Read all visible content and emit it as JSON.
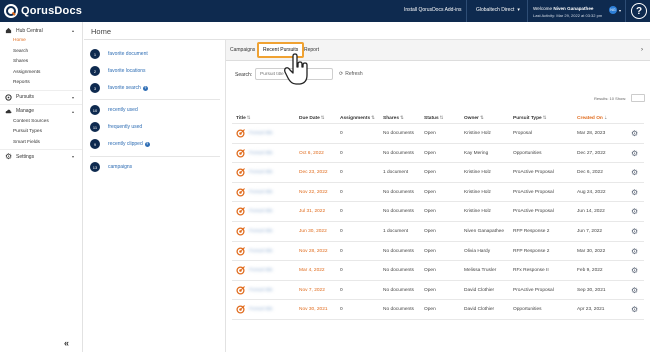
{
  "brand": {
    "name": "QorusDocs"
  },
  "topbar": {
    "addin_link": "Install QorusDocs Add-ins",
    "org": "Globaltech Direct",
    "welcome_prefix": "Welcome",
    "user_name": "Niven Ganapathee",
    "last_activity": "Last Activity: Mar 29, 2022 at 03:32 pm",
    "avatar_initials": "NG",
    "help": "?"
  },
  "sidebar": {
    "hub_central": "Hub Central",
    "hub_items": [
      "Home",
      "Search",
      "Shares",
      "Assignments",
      "Reports"
    ],
    "pursuits": "Pursuits",
    "manage": "Manage",
    "manage_items": [
      "Content Sources",
      "Pursuit Types",
      "Smart Fields"
    ],
    "settings": "Settings",
    "collapse": "«"
  },
  "page": {
    "title": "Home"
  },
  "favorites": [
    {
      "num": "1",
      "label": "favorite document"
    },
    {
      "num": "2",
      "label": "favorite locations"
    },
    {
      "num": "3",
      "label": "favorite search"
    },
    {
      "num": "10",
      "label": "recently used"
    },
    {
      "num": "11",
      "label": "frequently used"
    },
    {
      "num": "9",
      "label": "recently clipped"
    },
    {
      "num": "13",
      "label": "campaigns"
    }
  ],
  "tabs": [
    "Campaigns",
    "Recent Pursuits",
    "Report"
  ],
  "search": {
    "label": "Search:",
    "placeholder": "Pursuit title",
    "refresh": "Refresh"
  },
  "results": {
    "label": "Results: 10  Show:"
  },
  "table": {
    "headers": [
      "Title",
      "Due Date",
      "Assignments",
      "Shares",
      "Status",
      "Owner",
      "Pursuit Type",
      "Created On"
    ],
    "rows": [
      {
        "title": "Pursuit title",
        "due": "",
        "assign": "0",
        "shares": "No documents",
        "status": "Open",
        "owner": "Kristine Holz",
        "type": "Proposal",
        "created": "Mar 28, 2023"
      },
      {
        "title": "Pursuit title",
        "due": "Oct 6, 2022",
        "assign": "0",
        "shares": "No documents",
        "status": "Open",
        "owner": "Kay Mering",
        "type": "Opportunities",
        "created": "Dec 27, 2022"
      },
      {
        "title": "Pursuit title",
        "due": "Dec 23, 2022",
        "assign": "0",
        "shares": "1 document",
        "status": "Open",
        "owner": "Kristine Holz",
        "type": "ProActive Proposal",
        "created": "Dec 6, 2022"
      },
      {
        "title": "Pursuit title",
        "due": "Nov 22, 2022",
        "assign": "0",
        "shares": "No documents",
        "status": "Open",
        "owner": "Kristine Holz",
        "type": "ProActive Proposal",
        "created": "Aug 24, 2022"
      },
      {
        "title": "Pursuit title",
        "due": "Jul 31, 2022",
        "assign": "0",
        "shares": "No documents",
        "status": "Open",
        "owner": "Kristine Holz",
        "type": "ProActive Proposal",
        "created": "Jun 14, 2022"
      },
      {
        "title": "Pursuit title",
        "due": "Jun 30, 2022",
        "assign": "0",
        "shares": "1 document",
        "status": "Open",
        "owner": "Niven Ganapathee",
        "type": "RFP Response 2",
        "created": "Jun 7, 2022"
      },
      {
        "title": "Pursuit title",
        "due": "Nov 28, 2022",
        "assign": "0",
        "shares": "No documents",
        "status": "Open",
        "owner": "Olivia Hardy",
        "type": "RFP Response 2",
        "created": "Mar 30, 2022"
      },
      {
        "title": "Pursuit title",
        "due": "Mar 4, 2022",
        "assign": "0",
        "shares": "No documents",
        "status": "Open",
        "owner": "Melissa Trusler",
        "type": "RFx Response II",
        "created": "Feb 9, 2022"
      },
      {
        "title": "Pursuit title",
        "due": "Nov 7, 2022",
        "assign": "0",
        "shares": "No documents",
        "status": "Open",
        "owner": "David Clothier",
        "type": "ProActive Proposal",
        "created": "Sep 30, 2021"
      },
      {
        "title": "Pursuit title",
        "due": "Nov 30, 2021",
        "assign": "0",
        "shares": "No documents",
        "status": "Open",
        "owner": "David Clothier",
        "type": "Opportunities",
        "created": "Apr 23, 2021"
      }
    ]
  },
  "colors": {
    "navy": "#0e2a4f",
    "accent": "#e06a1b",
    "highlight": "#f0a232",
    "link": "#2e6db4"
  }
}
